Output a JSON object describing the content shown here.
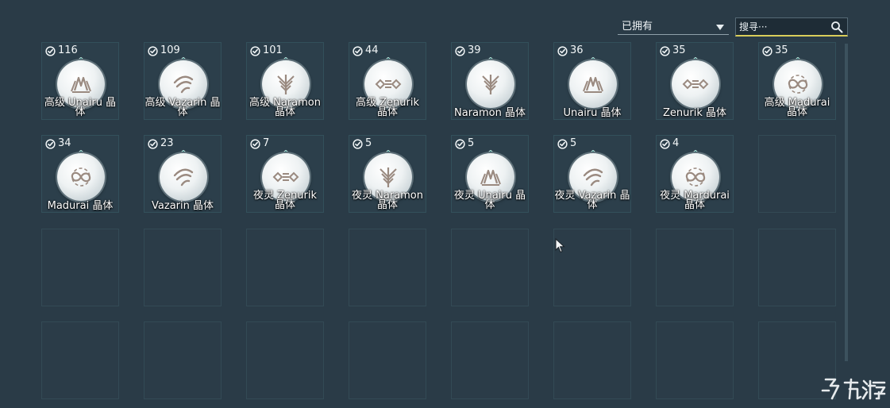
{
  "toolbar": {
    "filter_label": "已拥有",
    "search_placeholder": "搜寻···"
  },
  "items": [
    {
      "count": "116",
      "name": "高级 Unairu 晶体",
      "glyph": "unairu",
      "wrap": true
    },
    {
      "count": "109",
      "name": "高级 Vazarin 晶体",
      "glyph": "vazarin",
      "wrap": true
    },
    {
      "count": "101",
      "name": "高级 Naramon 晶体",
      "glyph": "naramon",
      "wrap": true
    },
    {
      "count": "44",
      "name": "高级 Zenurik 晶体",
      "glyph": "zenurik",
      "wrap": true
    },
    {
      "count": "39",
      "name": "Naramon 晶体",
      "glyph": "naramon",
      "wrap": false
    },
    {
      "count": "36",
      "name": "Unairu 晶体",
      "glyph": "unairu",
      "wrap": false
    },
    {
      "count": "35",
      "name": "Zenurik 晶体",
      "glyph": "zenurik",
      "wrap": false
    },
    {
      "count": "35",
      "name": "高级 Madurai 晶体",
      "glyph": "madurai",
      "wrap": true
    },
    {
      "count": "34",
      "name": "Madurai 晶体",
      "glyph": "madurai",
      "wrap": false
    },
    {
      "count": "23",
      "name": "Vazarin 晶体",
      "glyph": "vazarin",
      "wrap": false
    },
    {
      "count": "7",
      "name": "夜灵 Zenurik 晶体",
      "glyph": "zenurik",
      "wrap": true
    },
    {
      "count": "5",
      "name": "夜灵 Naramon 晶体",
      "glyph": "naramon",
      "wrap": true
    },
    {
      "count": "5",
      "name": "夜灵 Unairu 晶体",
      "glyph": "unairu",
      "wrap": true
    },
    {
      "count": "5",
      "name": "夜灵 Vazarin 晶体",
      "glyph": "vazarin",
      "wrap": true
    },
    {
      "count": "4",
      "name": "夜灵 Mardurai 晶体",
      "glyph": "madurai",
      "wrap": true
    }
  ],
  "icons": {
    "owned": "check-circle-icon",
    "search": "magnifier-icon",
    "filter": "caret-down-icon"
  },
  "colors": {
    "background": "#2a3b47",
    "slot_border": "#33505b",
    "glyph": "#9a8a80",
    "gem": "#2e8c84",
    "search_underline": "#d9cd5a"
  }
}
